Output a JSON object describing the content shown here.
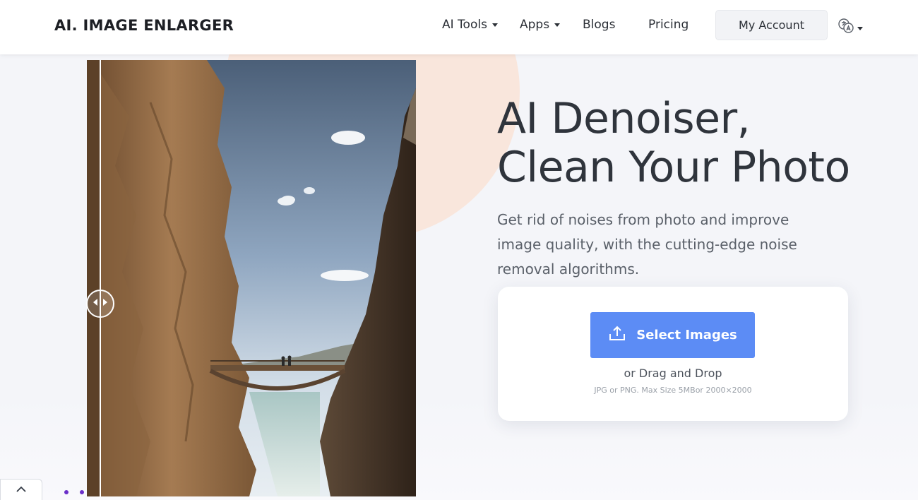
{
  "header": {
    "logo_text": "AI. IMAGE ENLARGER",
    "nav": [
      {
        "label": "AI Tools",
        "has_dropdown": true
      },
      {
        "label": "Apps",
        "has_dropdown": true
      },
      {
        "label": "Blogs",
        "has_dropdown": false
      },
      {
        "label": "Pricing",
        "has_dropdown": false
      }
    ],
    "account_label": "My Account",
    "language_icon": "translate-icon"
  },
  "hero": {
    "title": "AI Denoiser, Clean Your Photo",
    "description": "Get rid of noises from photo and improve image quality, with the cutting-edge noise removal algorithms."
  },
  "compare": {
    "image_subject": "cliff-walkway-bridge-photo",
    "slider_position": 0.04
  },
  "upload": {
    "button_label": "Select Images",
    "button_icon": "upload-icon",
    "drag_text": "or Drag and Drop",
    "hint": "JPG or PNG. Max Size 5MBor 2000×2000"
  },
  "colors": {
    "accent": "#5c8cf5",
    "peach": "#f9e6dc",
    "dot": "#6a2fc9"
  }
}
